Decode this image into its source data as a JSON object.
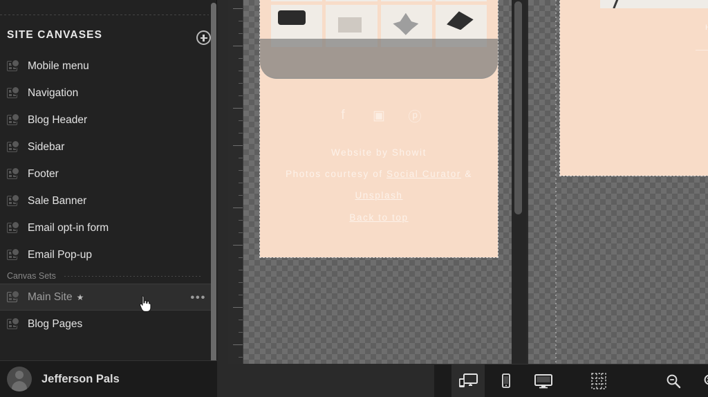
{
  "sidebar": {
    "title": "SITE CANVASES",
    "add_button_icon": "plus-circle-icon",
    "items": [
      {
        "label": "Mobile menu",
        "icon": "canvas-icon",
        "selected": false
      },
      {
        "label": "Navigation",
        "icon": "canvas-icon",
        "selected": false
      },
      {
        "label": "Blog Header",
        "icon": "canvas-icon",
        "selected": false
      },
      {
        "label": "Sidebar",
        "icon": "canvas-icon",
        "selected": false
      },
      {
        "label": "Footer",
        "icon": "canvas-icon",
        "selected": false
      },
      {
        "label": "Sale Banner",
        "icon": "canvas-icon",
        "selected": false
      },
      {
        "label": "Email opt-in form",
        "icon": "canvas-icon",
        "selected": false
      },
      {
        "label": "Email Pop-up",
        "icon": "canvas-icon",
        "selected": false
      }
    ],
    "section_label": "Canvas Sets",
    "sets": [
      {
        "label": "Main Site",
        "star": "★",
        "selected": true,
        "overflow": "•••"
      },
      {
        "label": "Blog Pages",
        "star": "",
        "selected": false,
        "overflow": ""
      }
    ],
    "user": {
      "name": "Jefferson Pals",
      "avatar_icon": "avatar-icon"
    }
  },
  "editor": {
    "mobile_canvas": {
      "background_color": "#F8DCC8",
      "social_icons": [
        {
          "name": "facebook-icon",
          "glyph": "f"
        },
        {
          "name": "instagram-icon",
          "glyph": "▣"
        },
        {
          "name": "pinterest-icon",
          "glyph": "ⓟ"
        }
      ],
      "footer_line_1": "Website by Showit",
      "footer_line_2_prefix": "Photos courtesy of ",
      "footer_link_1": "Social Curator",
      "footer_line_2_joiner": " &",
      "footer_link_2": "Unsplash",
      "back_to_top": "Back to top"
    },
    "desktop_canvas": {
      "background_color": "#F8DCC8",
      "partial_text": "H"
    }
  },
  "toolbar": {
    "buttons": [
      {
        "name": "responsive-view-button",
        "icon": "devices-icon",
        "active": true
      },
      {
        "name": "mobile-view-button",
        "icon": "mobile-icon",
        "active": false
      },
      {
        "name": "desktop-view-button",
        "icon": "desktop-icon",
        "active": false
      },
      {
        "name": "guides-toggle-button",
        "icon": "grid-guides-icon",
        "active": false
      },
      {
        "name": "zoom-out-button",
        "icon": "magnifier-minus-icon",
        "active": false
      },
      {
        "name": "zoom-reset-button",
        "icon": "magnifier-reset-icon",
        "active": false
      },
      {
        "name": "zoom-in-button",
        "icon": "magnifier-plus-icon",
        "active": false
      }
    ]
  },
  "cursor": {
    "type": "pointer-hand-cursor"
  }
}
